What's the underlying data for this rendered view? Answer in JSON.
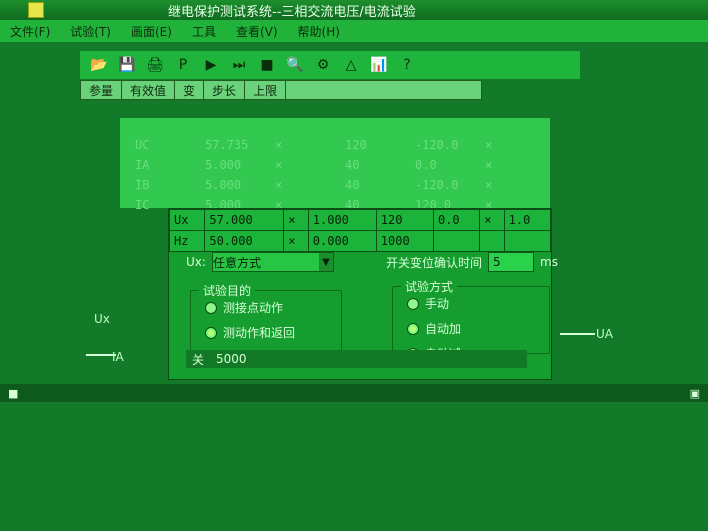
{
  "window": {
    "title": "继电保护测试系统--三相交流电压/电流试验"
  },
  "menu": [
    "文件(F)",
    "试验(T)",
    "画面(E)",
    "工具",
    "查看(V)",
    "帮助(H)"
  ],
  "toolbar": {
    "icons": [
      "open-icon",
      "save-icon",
      "print-icon",
      "parameter-icon",
      "play-icon",
      "step-icon",
      "stop-icon",
      "search-icon",
      "settings-icon",
      "triangle-icon",
      "chart-icon",
      "help-icon"
    ]
  },
  "table_header": [
    "参量",
    "有效值",
    "变",
    "步长",
    "上限"
  ],
  "rows": [
    [
      "UC",
      "57.735",
      "×",
      "120",
      "-120.0",
      "×"
    ],
    [
      "IA",
      "5.000",
      "×",
      "40",
      "0.0",
      "×"
    ],
    [
      "IB",
      "5.000",
      "×",
      "40",
      "-120.0",
      "×"
    ],
    [
      "IC",
      "5.000",
      "×",
      "40",
      "120.0",
      "×"
    ]
  ],
  "panel_table": [
    [
      "Ux",
      "57.000",
      "×",
      "1.000",
      "120",
      "0.0",
      "×",
      "1.0"
    ],
    [
      "Hz",
      "50.000",
      "×",
      "0.000",
      "1000",
      "",
      "",
      ""
    ]
  ],
  "ux": {
    "label": "Ux:",
    "mode": "任意方式"
  },
  "confirm": {
    "label": "开关变位确认时间",
    "value": "5",
    "unit": "ms"
  },
  "purpose": {
    "title": "试验目的",
    "options": [
      "测接点动作",
      "测动作和返回"
    ],
    "selected": 1
  },
  "method": {
    "title": "试验方式",
    "options": [
      "手动",
      "自动加",
      "自动减"
    ],
    "selected": 1
  },
  "bottom": {
    "left": "关",
    "value": "5000"
  },
  "side": {
    "left_ia": "IA",
    "right_ua": "UA",
    "left_small": "Ux"
  }
}
